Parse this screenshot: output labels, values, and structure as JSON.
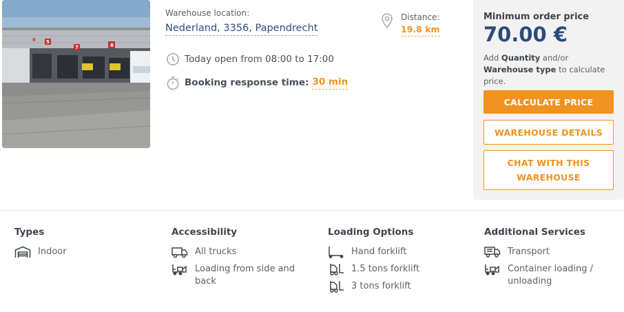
{
  "listing": {
    "location_label": "Warehouse location:",
    "location_value": "Nederland, 3356, Papendrecht",
    "distance_label": "Distance:",
    "distance_value": "19.8 km",
    "hours": "Today open from 08:00 to 17:00",
    "booking_label": "Booking response time:",
    "booking_value": "30 min",
    "photo_dock_numbers": [
      "5",
      "6",
      "7",
      "8"
    ]
  },
  "price_panel": {
    "title": "Minimum order price",
    "price": "70.00 €",
    "note_prefix": "Add ",
    "note_quantity": "Quantity",
    "note_middle": " and/or ",
    "note_type": "Warehouse type",
    "note_suffix": " to calculate price.",
    "calculate_label": "CALCULATE PRICE",
    "details_label": "WAREHOUSE DETAILS",
    "chat_label": "CHAT WITH THIS WAREHOUSE"
  },
  "features": {
    "types": {
      "title": "Types",
      "items": [
        {
          "icon": "warehouse-icon",
          "label": "Indoor"
        }
      ]
    },
    "accessibility": {
      "title": "Accessibility",
      "items": [
        {
          "icon": "truck-icon",
          "label": "All trucks"
        },
        {
          "icon": "forklift-loading-icon",
          "label": "Loading from side and back"
        }
      ]
    },
    "loading": {
      "title": "Loading Options",
      "items": [
        {
          "icon": "hand-forklift-icon",
          "label": "Hand forklift"
        },
        {
          "icon": "forklift-icon",
          "label": "1.5 tons forklift"
        },
        {
          "icon": "forklift-icon",
          "label": "3 tons forklift"
        }
      ]
    },
    "services": {
      "title": "Additional Services",
      "items": [
        {
          "icon": "truck-transport-icon",
          "label": "Transport"
        },
        {
          "icon": "forklift-loading-icon",
          "label": "Container loading / unloading"
        }
      ]
    }
  },
  "colors": {
    "accent": "#f29220",
    "navy": "#2d4b7a",
    "panel_bg": "#f2f2f2",
    "text": "#4a4f57"
  }
}
